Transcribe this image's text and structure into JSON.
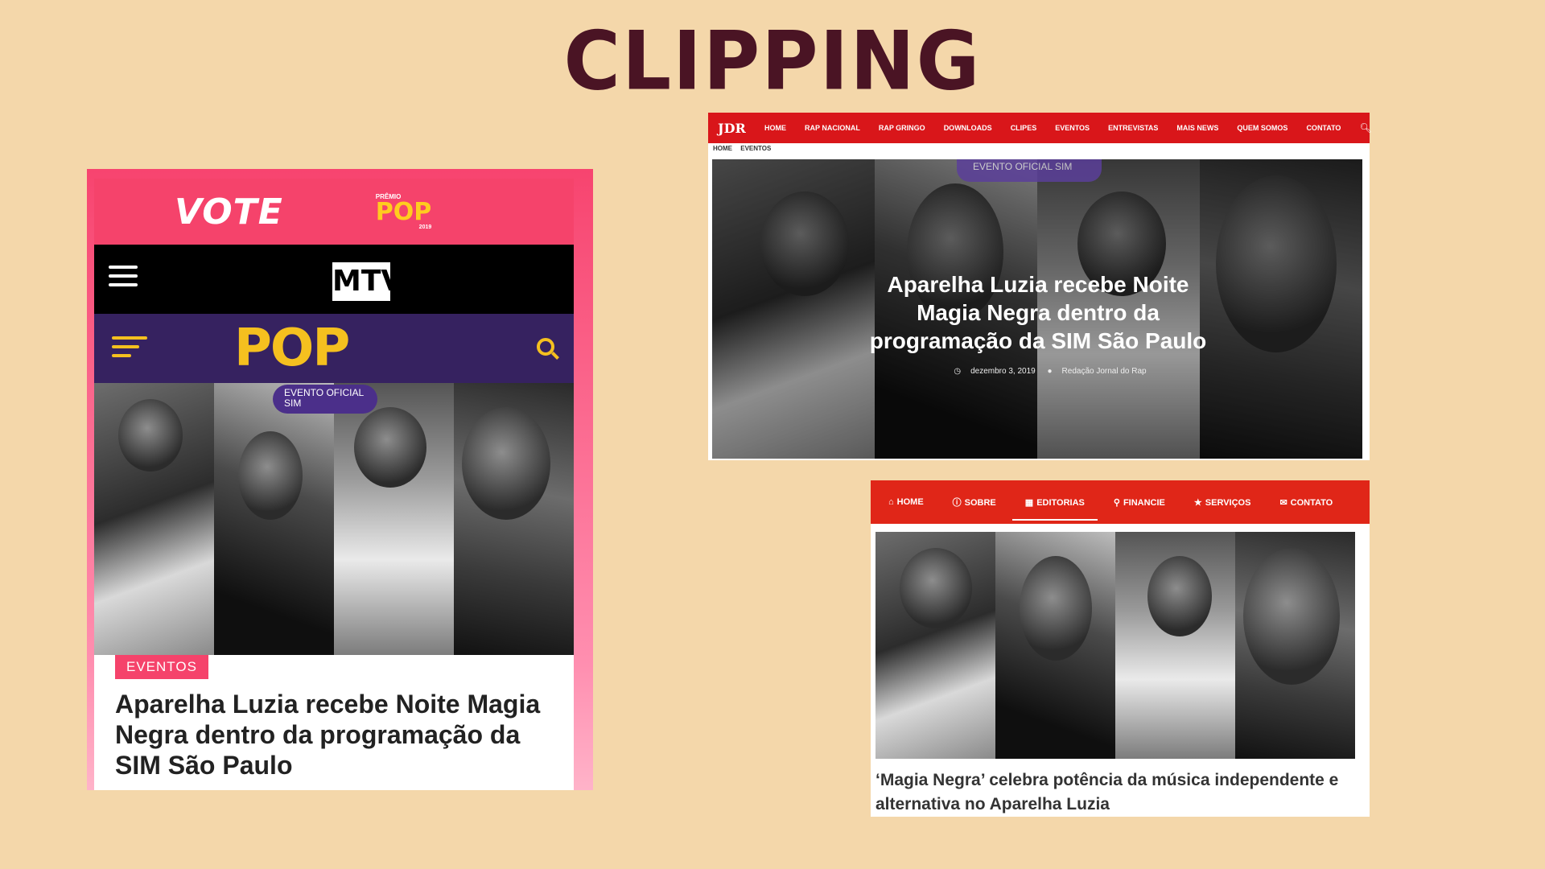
{
  "page_title": "CLIPPING",
  "clip_mtv": {
    "vote_label": "VOTE",
    "premio_small": "PRÊMIO",
    "premio_name": "POP",
    "premio_year": "2019",
    "mtv_logo": "MTV",
    "pop_logo": "POP",
    "badge": "EVENTO OFICIAL SIM",
    "category": "EVENTOS",
    "headline": "Aparelha Luzia recebe Noite Magia Negra dentro da programação da SIM São Paulo"
  },
  "clip_jornal": {
    "logo": "JDR",
    "nav": [
      "HOME",
      "RAP NACIONAL",
      "RAP GRINGO",
      "DOWNLOADS",
      "CLIPES",
      "EVENTOS",
      "ENTREVISTAS",
      "MAIS NEWS",
      "QUEM SOMOS",
      "CONTATO"
    ],
    "search_icon": "search-icon",
    "breadcrumb": [
      "HOME",
      "EVENTOS"
    ],
    "badge": "EVENTO OFICIAL SIM",
    "headline": "Aparelha Luzia recebe Noite Magia Negra dentro da programação da SIM São Paulo",
    "date": "dezembro 3, 2019",
    "author": "Redação Jornal do Rap"
  },
  "clip_site": {
    "nav": [
      "HOME",
      "SOBRE",
      "EDITORIAS",
      "FINANCIE",
      "SERVIÇOS",
      "CONTATO"
    ],
    "active_nav": "EDITORIAS",
    "headline": "‘Magia Negra’ celebra potência da música independente e alternativa no Aparelha Luzia"
  },
  "colors": {
    "background": "#f4d7aa",
    "title": "#4a1424",
    "mtv_pink": "#f5436b",
    "pop_purple": "#362260",
    "pop_yellow": "#f5c01f",
    "jornal_red": "#d9161a",
    "site_red": "#e02618"
  }
}
